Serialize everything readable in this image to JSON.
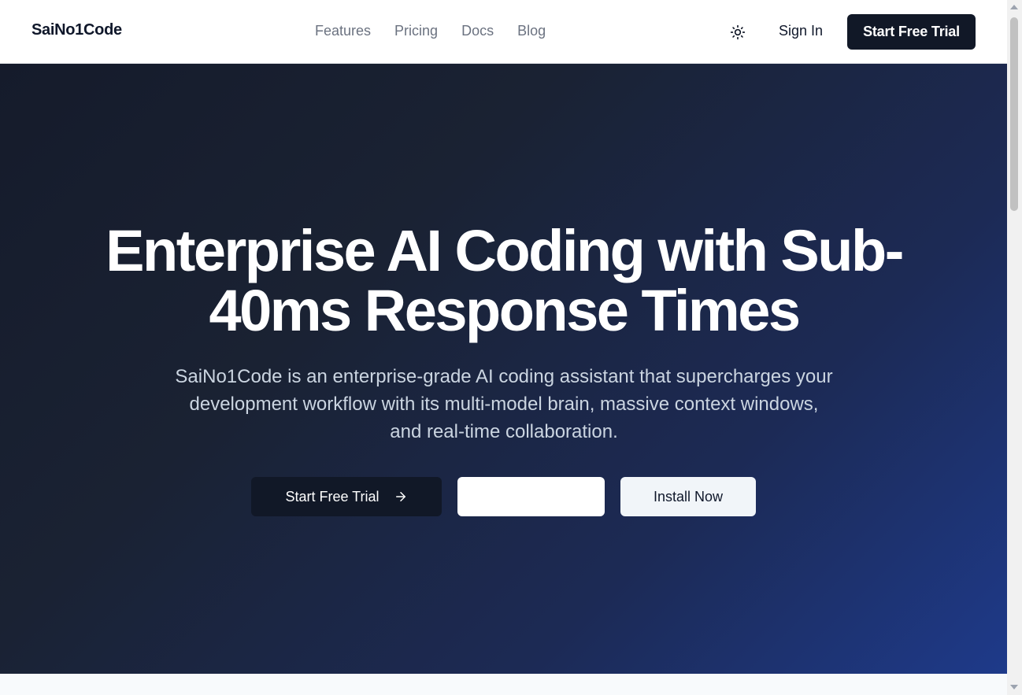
{
  "header": {
    "logo": "SaiNo1Code",
    "nav": [
      "Features",
      "Pricing",
      "Docs",
      "Blog"
    ],
    "theme_icon": "sun-icon",
    "sign_in": "Sign In",
    "cta": "Start Free Trial"
  },
  "hero": {
    "title": "Enterprise AI Coding with Sub-40ms Response Times",
    "subtitle": "SaiNo1Code is an enterprise-grade AI coding assistant that supercharges your development workflow with its multi-model brain, massive context windows, and real-time collaboration.",
    "primary_button": "Start Free Trial",
    "primary_icon": "arrow-right-icon",
    "secondary_button": "",
    "install_button": "Install Now"
  },
  "colors": {
    "accent_dark": "#111827",
    "hero_gradient_start": "#151b2b",
    "hero_gradient_end": "#1e3a8a",
    "subtitle": "#cbd5e1"
  }
}
